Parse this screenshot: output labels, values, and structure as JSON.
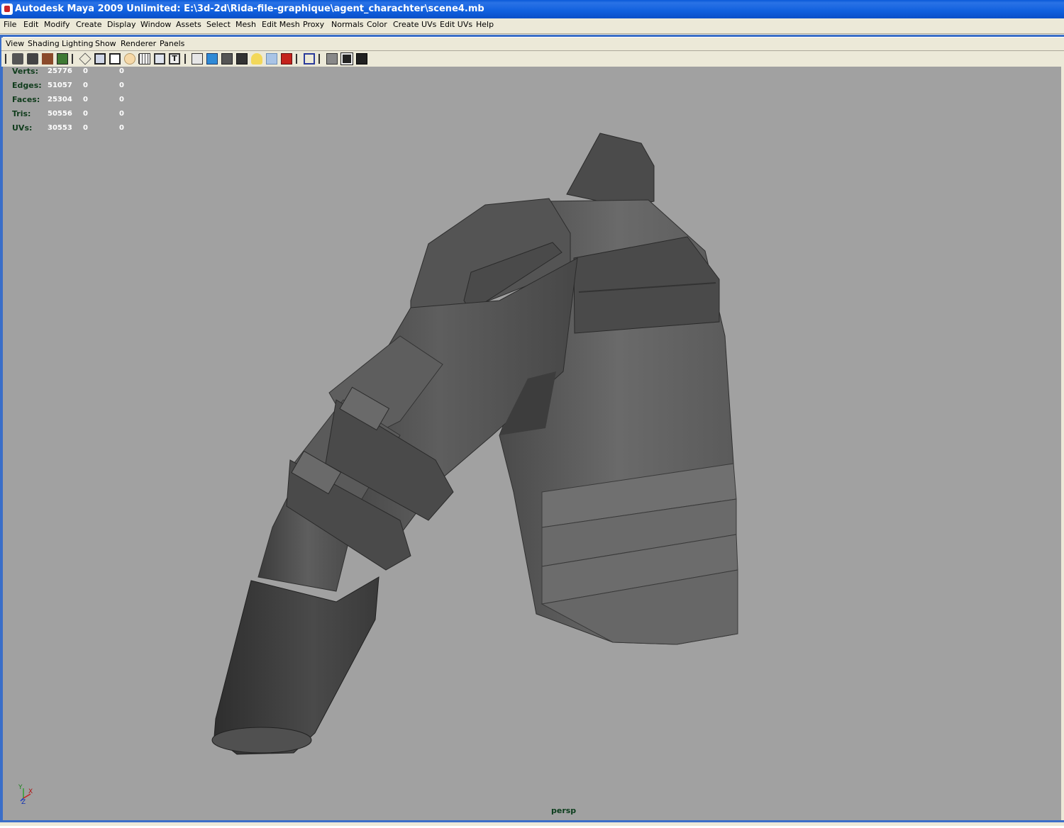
{
  "window": {
    "title": "Autodesk Maya 2009 Unlimited: E:\\3d-2d\\Rida-file-graphique\\agent_charachter\\scene4.mb"
  },
  "menubar": {
    "items": [
      "File",
      "Edit",
      "Modify",
      "Create",
      "Display",
      "Window",
      "Assets",
      "Select",
      "Mesh",
      "Edit Mesh",
      "Proxy",
      "Normals",
      "Color",
      "Create UVs",
      "Edit UVs",
      "Help"
    ]
  },
  "panel_menu": {
    "items": [
      "View",
      "Shading",
      "Lighting",
      "Show",
      "Renderer",
      "Panels"
    ]
  },
  "toolbar": {
    "icons": [
      "select-camera-icon",
      "camera-attributes-icon",
      "bookmark-icon",
      "image-plane-icon",
      "grid-icon",
      "film-gate-icon",
      "resolution-gate-icon",
      "gate-mask-icon",
      "field-chart-icon",
      "safe-action-icon",
      "safe-title-icon",
      "wireframe-icon",
      "smooth-shade-icon",
      "flat-shade-icon",
      "bounding-box-icon",
      "use-lights-icon",
      "textured-icon",
      "shadows-icon",
      "isolate-select-icon",
      "xray-icon",
      "wireframe-on-shaded-icon",
      "backface-cull-icon"
    ]
  },
  "hud": {
    "rows": [
      {
        "label": "Verts:",
        "total": "25776",
        "sel": "0",
        "comp": "0"
      },
      {
        "label": "Edges:",
        "total": "51057",
        "sel": "0",
        "comp": "0"
      },
      {
        "label": "Faces:",
        "total": "25304",
        "sel": "0",
        "comp": "0"
      },
      {
        "label": "Tris:",
        "total": "50556",
        "sel": "0",
        "comp": "0"
      },
      {
        "label": "UVs:",
        "total": "30553",
        "sel": "0",
        "comp": "0"
      }
    ]
  },
  "viewport": {
    "camera": "persp",
    "background": "#a1a1a1",
    "axis": {
      "x": "X",
      "y": "Y",
      "z": "Z"
    }
  }
}
